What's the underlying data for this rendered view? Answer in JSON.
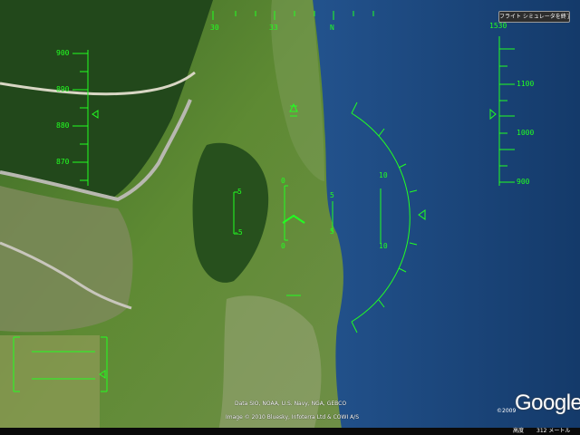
{
  "exit_button_label": "フライト シミュレータを終了",
  "heading_tape": {
    "labels": [
      "30",
      "33",
      "N"
    ]
  },
  "altitude_tape": {
    "labels": [
      "1530",
      "1100",
      "1000",
      "900"
    ]
  },
  "speed_tape": {
    "labels": [
      "900",
      "890",
      "880",
      "870"
    ]
  },
  "pitch_ladder": {
    "labels": [
      "5",
      "-5",
      "0",
      "0",
      "5",
      "5"
    ]
  },
  "roll_scale": {
    "labels": [
      "10",
      "10"
    ]
  },
  "credits": {
    "data_line": "Data SIO, NOAA, U.S. Navy, NGA, GEBCO",
    "image_line": "Image © 2010 Bluesky, Infoterra Ltd & COWI A/S"
  },
  "logo": {
    "year": "©2009",
    "text": "Google"
  },
  "status_bar": {
    "altitude_label": "高度",
    "altitude_value": "312 メートル"
  },
  "colors": {
    "hud": "#22ff22",
    "sea": "#1d4e86",
    "land": "#4f7a2e",
    "forest": "#234a1c"
  }
}
